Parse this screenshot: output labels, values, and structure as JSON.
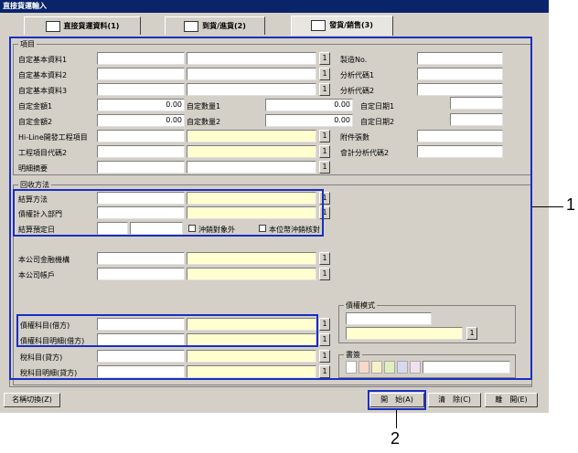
{
  "window": {
    "title": "直接貨運輸入"
  },
  "tabs": [
    {
      "label": "直接貨運資料(1)",
      "active": false
    },
    {
      "label": "到貨/進貨(2)",
      "active": false
    },
    {
      "label": "發貨/銷售(3)",
      "active": true
    }
  ],
  "items_group": {
    "title": "項目",
    "rows": {
      "custom_basic_1": "自定基本資料1",
      "custom_basic_2": "自定基本資料2",
      "custom_basic_3": "自定基本資料3",
      "custom_amount_1": "自定金額1",
      "custom_amount_2": "自定金額2",
      "hiline_project": "Hi-Line開發工程項目",
      "project_code_2": "工程項目代碼2",
      "detail_summary": "明細摘要",
      "mfg_no": "製造No.",
      "analysis_code_1": "分析代碼1",
      "analysis_code_2": "分析代碼2",
      "custom_qty_1": "自定數量1",
      "custom_qty_2": "自定數量2",
      "custom_date_1": "自定日期1",
      "custom_date_2": "自定日期2",
      "attachments": "附件張數",
      "acct_analysis_2": "會計分析代碼2"
    },
    "values": {
      "amount_1": "0.00",
      "amount_2": "0.00",
      "qty_1": "0.00",
      "qty_2": "0.00"
    }
  },
  "collection_group": {
    "title": "回收方法",
    "settlement_method": "結算方法",
    "claim_dept": "債權計入部門",
    "settlement_date": "結算預定日",
    "offset_excluded": "沖銷對象外",
    "local_currency_offset": "本位幣沖銷核對",
    "company_bank": "本公司金融機構",
    "company_account": "本公司帳戶",
    "claim_subject_debit": "債權科目(借方)",
    "claim_subject_detail_debit": "債權科目明細(借方)",
    "tax_subject_credit": "稅科目(貸方)",
    "tax_subject_detail_credit": "稅科目明細(貸方)",
    "claim_mode": "債權模式",
    "memo": "書簽"
  },
  "lookup_button": "1",
  "buttons": {
    "name_switch": "名稱切換(Z)",
    "start": "開　始(A)",
    "clear": "清　除(C)",
    "close": "離　開(E)"
  },
  "callouts": {
    "c1": "1",
    "c2": "2"
  },
  "colors": {
    "highlight": "#1a2fbf",
    "yellow_field": "#ffffd0",
    "title_bar": "#0a246a"
  }
}
